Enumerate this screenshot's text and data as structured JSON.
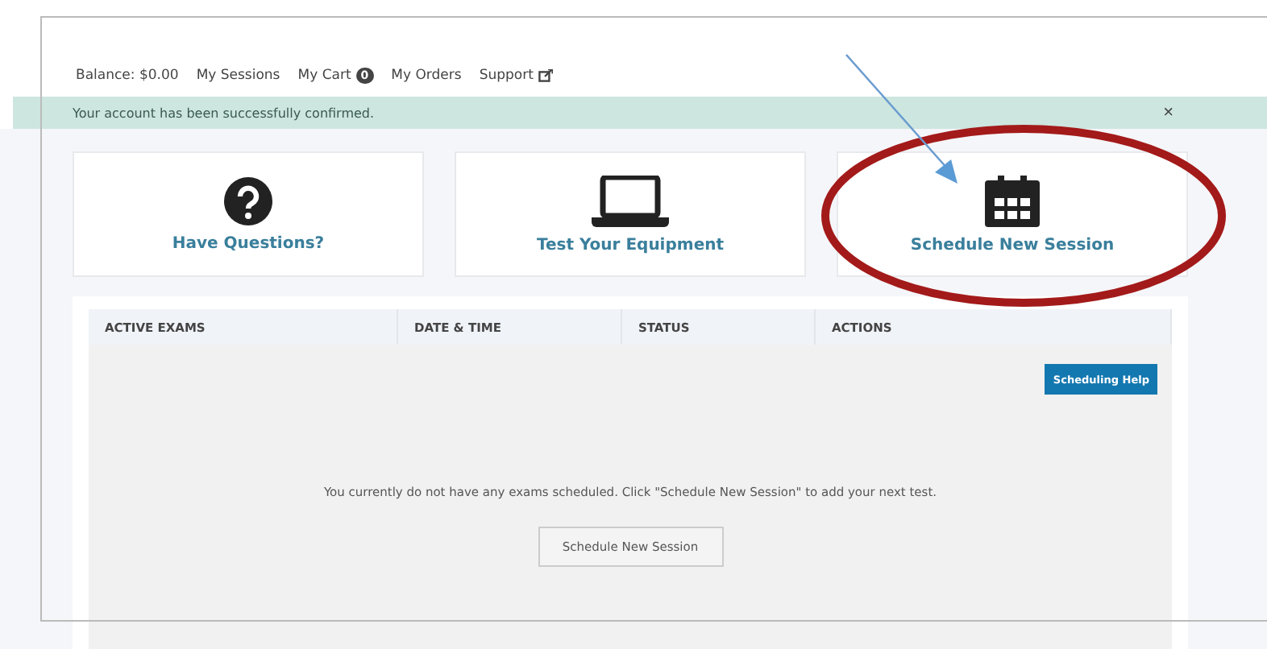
{
  "nav": [
    {
      "kind": "text",
      "label": "Balance: $0.00"
    },
    {
      "kind": "link",
      "label": "My Sessions"
    },
    {
      "kind": "badge",
      "label": "My Cart",
      "badge": "0"
    },
    {
      "kind": "link",
      "label": "My Orders"
    },
    {
      "kind": "external",
      "label": "Support"
    }
  ],
  "alert": {
    "message": "Your account has been successfully confirmed.",
    "close": "×"
  },
  "cards": [
    {
      "kind": "question",
      "label": "Have Questions?"
    },
    {
      "kind": "laptop",
      "label": "Test Your Equipment"
    },
    {
      "kind": "calendar",
      "label": "Schedule New Session"
    }
  ],
  "table": {
    "columns": [
      "ACTIVE EXAMS",
      "DATE & TIME",
      "STATUS",
      "ACTIONS"
    ],
    "help_button": "Scheduling Help",
    "empty_message": "You currently do not have any exams scheduled. Click \"Schedule New Session\" to add your next test.",
    "empty_button": "Schedule New Session"
  }
}
